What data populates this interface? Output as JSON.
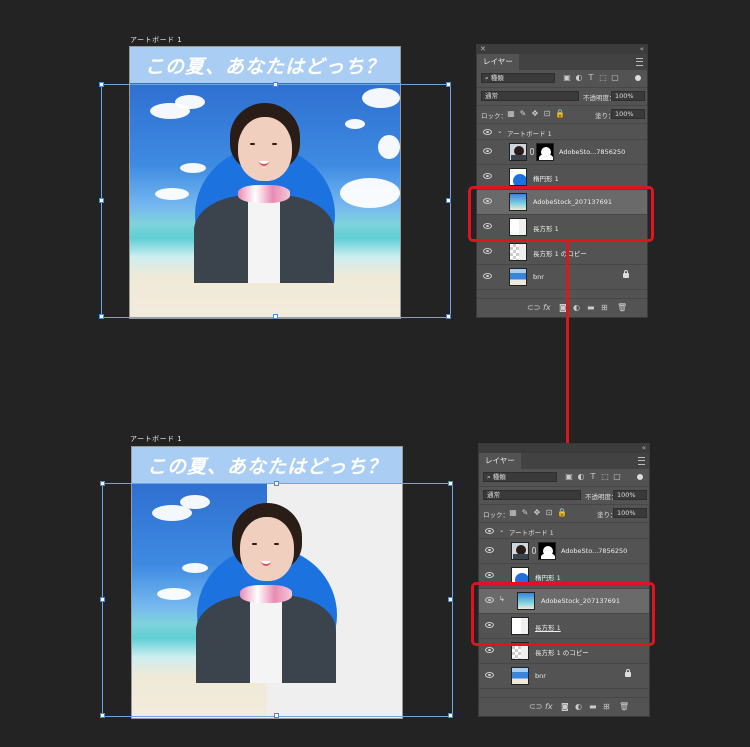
{
  "artboard_label": "アートボード 1",
  "banner_text": "この夏、あなたはどっち？",
  "panel": {
    "tab_label": "レイヤー",
    "filter_kind": "種類",
    "blend_mode": "通常",
    "opacity_label": "不透明度：",
    "opacity_value": "100%",
    "lock_label": "ロック：",
    "fill_label": "塗り：",
    "fill_value": "100%",
    "group_name": "アートボード 1"
  },
  "layers_before": [
    {
      "name": "AdobeSto...7856250"
    },
    {
      "name": "楕円形 1"
    },
    {
      "name": "AdobeStock_207137691"
    },
    {
      "name": "長方形 1"
    },
    {
      "name": "長方形 1 のコピー"
    },
    {
      "name": "bnr"
    }
  ],
  "layers_after": [
    {
      "name": "AdobeSto...7856250"
    },
    {
      "name": "楕円形 1"
    },
    {
      "name": "AdobeStock_207137691"
    },
    {
      "name": "長方形 1"
    },
    {
      "name": "長方形 1 のコピー"
    },
    {
      "name": "bnr"
    }
  ],
  "colors": {
    "highlight": "#e0141e",
    "panel_bg": "#535353",
    "canvas_bg": "#232323",
    "circle_blue": "#1c73e0"
  },
  "icons": [
    "close-icon",
    "collapse-icon",
    "panel-menu-icon",
    "search-icon",
    "eye-icon",
    "lock-icon",
    "link-icon",
    "fx-icon",
    "mask-icon",
    "adjustment-icon",
    "folder-icon",
    "new-layer-icon",
    "trash-icon"
  ]
}
